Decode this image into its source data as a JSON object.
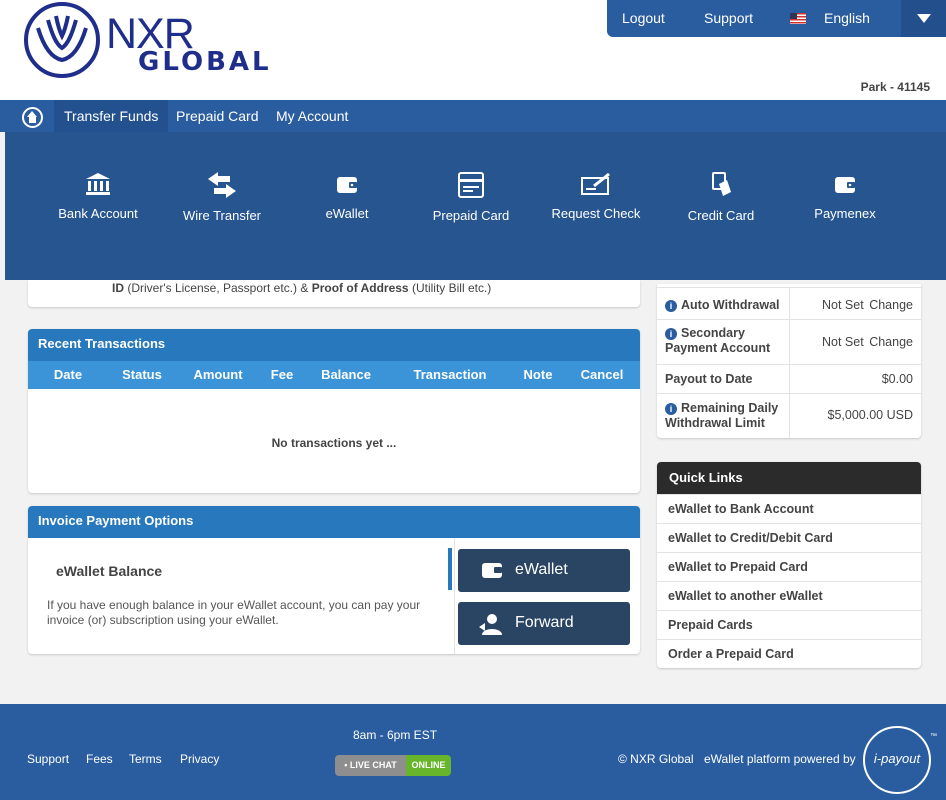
{
  "brand": {
    "name_top": "NXR",
    "name_bottom": "GLOBAL"
  },
  "topbar": {
    "logout": "Logout",
    "support": "Support",
    "language": "English"
  },
  "user_id": "Park - 41145",
  "nav": {
    "items": [
      "Transfer Funds",
      "Prepaid Card",
      "My Account"
    ]
  },
  "mega_menu": {
    "items": [
      {
        "label": "Bank Account",
        "icon": "bank-icon"
      },
      {
        "label": "Wire Transfer",
        "icon": "arrows-icon"
      },
      {
        "label": "eWallet",
        "icon": "wallet-icon"
      },
      {
        "label": "Prepaid Card",
        "icon": "card-icon"
      },
      {
        "label": "Request Check",
        "icon": "check-icon"
      },
      {
        "label": "Credit Card",
        "icon": "credit-card-icon"
      },
      {
        "label": "Paymenex",
        "icon": "wallet-icon"
      }
    ]
  },
  "verification": {
    "id_label": "ID",
    "id_hint": "(Driver's License, Passport etc.) &",
    "proof_label": "Proof of Address",
    "proof_hint": "(Utility Bill etc.)"
  },
  "recent_transactions": {
    "title": "Recent Transactions",
    "columns": [
      "Date",
      "Status",
      "Amount",
      "Fee",
      "Balance",
      "Transaction",
      "Note",
      "Cancel"
    ],
    "empty": "No transactions yet ..."
  },
  "invoice": {
    "title": "Invoice Payment Options",
    "balance_title": "eWallet Balance",
    "description": "If you have enough balance in your eWallet account, you can pay your invoice (or) subscription using your eWallet.",
    "ewallet_button": "eWallet",
    "forward_button": "Forward"
  },
  "account_summary": {
    "auto_withdrawal": {
      "label": "Auto Withdrawal",
      "value": "Not Set",
      "action": "Change"
    },
    "secondary_account": {
      "label": "Secondary Payment Account",
      "value": "Not Set",
      "action": "Change"
    },
    "payout_to_date": {
      "label": "Payout to Date",
      "value": "$0.00"
    },
    "daily_limit": {
      "label": "Remaining Daily Withdrawal Limit",
      "value": "$5,000.00 USD"
    }
  },
  "quick_links": {
    "title": "Quick Links",
    "items": [
      "eWallet to Bank Account",
      "eWallet to Credit/Debit Card",
      "eWallet to Prepaid Card",
      "eWallet to another eWallet",
      "Prepaid Cards",
      "Order a Prepaid Card"
    ]
  },
  "footer": {
    "links": [
      "Support",
      "Fees",
      "Terms",
      "Privacy"
    ],
    "hours": "8am - 6pm EST",
    "livechat_left": "• LIVE CHAT",
    "livechat_right": "ONLINE",
    "copyright": "© NXR Global",
    "powered_by": "eWallet platform powered by",
    "partner": "i-payout",
    "partner_tm": "™"
  },
  "colors": {
    "primary": "#2a5da0",
    "accent": "#2878bd",
    "dark_button": "#2a4563"
  }
}
